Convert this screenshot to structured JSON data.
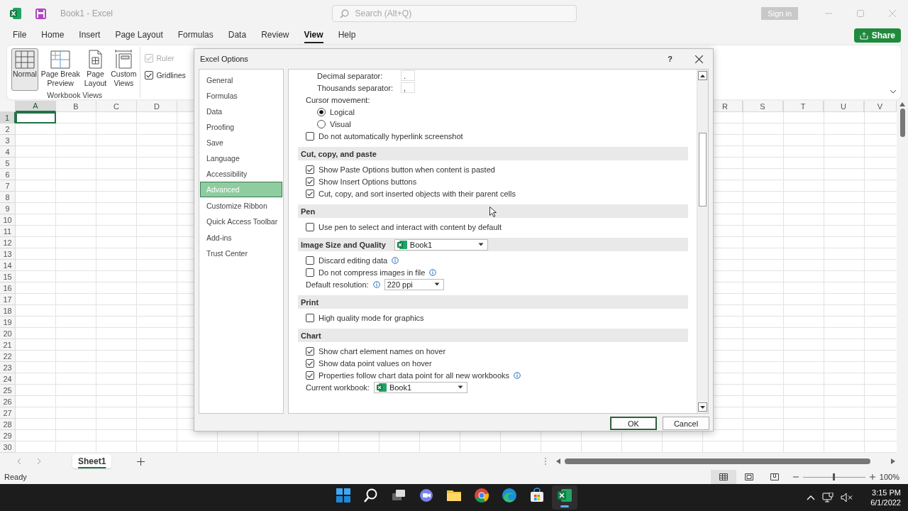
{
  "title_bar": {
    "title": "Book1 - Excel",
    "search_placeholder": "Search (Alt+Q)",
    "sign_in": "Sign in"
  },
  "ribbon_tabs": [
    {
      "label": "File",
      "selected": false
    },
    {
      "label": "Home",
      "selected": false
    },
    {
      "label": "Insert",
      "selected": false
    },
    {
      "label": "Page Layout",
      "selected": false
    },
    {
      "label": "Formulas",
      "selected": false
    },
    {
      "label": "Data",
      "selected": false
    },
    {
      "label": "Review",
      "selected": false
    },
    {
      "label": "View",
      "selected": true
    },
    {
      "label": "Help",
      "selected": false
    }
  ],
  "share_button": "Share",
  "ribbon": {
    "view_buttons": [
      {
        "kind": "normal",
        "label": "Normal",
        "selected": true
      },
      {
        "kind": "page_break",
        "label": "Page Break\nPreview",
        "selected": false
      },
      {
        "kind": "page_layout",
        "label": "Page\nLayout",
        "selected": false
      },
      {
        "kind": "custom",
        "label": "Custom\nViews",
        "selected": false
      }
    ],
    "group_label": "Workbook Views",
    "checkboxes": [
      {
        "label": "Ruler",
        "checked": true,
        "disabled": true
      },
      {
        "label": "Gridlines",
        "checked": true,
        "disabled": false
      }
    ]
  },
  "grid": {
    "columns_left": [
      {
        "label": "A",
        "selected": true
      },
      {
        "label": "B",
        "selected": false
      },
      {
        "label": "C",
        "selected": false
      },
      {
        "label": "D",
        "selected": false
      }
    ],
    "columns_right": [
      {
        "label": "R",
        "selected": false
      },
      {
        "label": "S",
        "selected": false
      },
      {
        "label": "T",
        "selected": false
      },
      {
        "label": "U",
        "selected": false
      },
      {
        "label": "V",
        "selected": false
      }
    ],
    "rows": [
      {
        "label": "1",
        "selected": true
      },
      {
        "label": "2",
        "selected": false
      },
      {
        "label": "3",
        "selected": false
      },
      {
        "label": "4",
        "selected": false
      },
      {
        "label": "5",
        "selected": false
      },
      {
        "label": "6",
        "selected": false
      },
      {
        "label": "7",
        "selected": false
      },
      {
        "label": "8",
        "selected": false
      },
      {
        "label": "9",
        "selected": false
      },
      {
        "label": "10",
        "selected": false
      },
      {
        "label": "11",
        "selected": false
      },
      {
        "label": "12",
        "selected": false
      },
      {
        "label": "13",
        "selected": false
      },
      {
        "label": "14",
        "selected": false
      },
      {
        "label": "15",
        "selected": false
      },
      {
        "label": "16",
        "selected": false
      },
      {
        "label": "17",
        "selected": false
      },
      {
        "label": "18",
        "selected": false
      },
      {
        "label": "19",
        "selected": false
      },
      {
        "label": "20",
        "selected": false
      },
      {
        "label": "21",
        "selected": false
      },
      {
        "label": "22",
        "selected": false
      },
      {
        "label": "23",
        "selected": false
      },
      {
        "label": "24",
        "selected": false
      },
      {
        "label": "25",
        "selected": false
      },
      {
        "label": "26",
        "selected": false
      },
      {
        "label": "27",
        "selected": false
      },
      {
        "label": "28",
        "selected": false
      },
      {
        "label": "29",
        "selected": false
      },
      {
        "label": "30",
        "selected": false
      }
    ]
  },
  "sheet_tabs": [
    {
      "label": "Sheet1",
      "selected": true
    }
  ],
  "status_bar": {
    "status": "Ready",
    "views": [
      {
        "kind": "normal",
        "selected": true
      },
      {
        "kind": "page_layout",
        "selected": false
      },
      {
        "kind": "page_break",
        "selected": false
      }
    ],
    "zoom": {
      "level": 0.5
    },
    "zoom_reading": "100%"
  },
  "taskbar": {
    "apps": [
      {
        "kind": "start",
        "active": false
      },
      {
        "kind": "search",
        "active": false
      },
      {
        "kind": "task_view",
        "active": false
      },
      {
        "kind": "chat",
        "active": false
      },
      {
        "kind": "explorer",
        "active": false
      },
      {
        "kind": "chrome",
        "active": false
      },
      {
        "kind": "edge",
        "active": false
      },
      {
        "kind": "store",
        "active": false
      },
      {
        "kind": "excel",
        "active": true
      }
    ],
    "time": "3:15 PM",
    "date": "6/1/2022"
  },
  "dialog": {
    "title": "Excel Options",
    "help": "?",
    "nav_groups": [
      [
        {
          "label": "General",
          "selected": false
        },
        {
          "label": "Formulas",
          "selected": false
        },
        {
          "label": "Data",
          "selected": false
        },
        {
          "label": "Proofing",
          "selected": false
        },
        {
          "label": "Save",
          "selected": false
        },
        {
          "label": "Language",
          "selected": false
        },
        {
          "label": "Accessibility",
          "selected": false
        },
        {
          "label": "Advanced",
          "selected": true
        }
      ],
      [
        {
          "label": "Customize Ribbon",
          "selected": false
        },
        {
          "label": "Quick Access Toolbar",
          "selected": false
        }
      ],
      [
        {
          "label": "Add-ins",
          "selected": false
        },
        {
          "label": "Trust Center",
          "selected": false
        }
      ]
    ],
    "settings": [
      {
        "kind": "field",
        "label": "Decimal separator:",
        "value": "."
      },
      {
        "kind": "field",
        "label": "Thousands separator:",
        "value": ","
      },
      {
        "kind": "label",
        "label": "Cursor movement:"
      },
      {
        "kind": "radio",
        "label": "Logical",
        "selected": true
      },
      {
        "kind": "radio",
        "label": "Visual",
        "selected": false
      },
      {
        "kind": "checkbox",
        "label": "Do not automatically hyperlink screenshot",
        "checked": false,
        "info": false
      },
      {
        "kind": "header",
        "label": "Cut, copy, and paste"
      },
      {
        "kind": "checkbox",
        "label": "Show Paste Options button when content is pasted",
        "checked": true,
        "info": false
      },
      {
        "kind": "checkbox",
        "label": "Show Insert Options buttons",
        "checked": true,
        "info": false
      },
      {
        "kind": "checkbox",
        "label": "Cut, copy, and sort inserted objects with their parent cells",
        "checked": true,
        "info": false
      },
      {
        "kind": "header",
        "label": "Pen"
      },
      {
        "kind": "checkbox",
        "label": "Use pen to select and interact with content by default",
        "checked": false,
        "info": false
      },
      {
        "kind": "header",
        "label": "Image Size and Quality",
        "dropdown": "Book1"
      },
      {
        "kind": "checkbox",
        "label": "Discard editing data",
        "checked": false,
        "info": true
      },
      {
        "kind": "checkbox",
        "label": "Do not compress images in file",
        "checked": false,
        "info": true
      },
      {
        "kind": "dropdown",
        "label": "Default resolution:",
        "info": true,
        "value": "220 ppi"
      },
      {
        "kind": "header",
        "label": "Print"
      },
      {
        "kind": "checkbox",
        "label": "High quality mode for graphics",
        "checked": false,
        "info": false
      },
      {
        "kind": "header",
        "label": "Chart"
      },
      {
        "kind": "checkbox",
        "label": "Show chart element names on hover",
        "checked": true,
        "info": false
      },
      {
        "kind": "checkbox",
        "label": "Show data point values on hover",
        "checked": true,
        "info": false
      },
      {
        "kind": "checkbox",
        "label": "Properties follow chart data point for all new workbooks",
        "checked": true,
        "info": true
      },
      {
        "kind": "workbook_dropdown",
        "label": "Current workbook:",
        "info": false,
        "value": "Book1"
      }
    ],
    "buttons": [
      {
        "label": "OK",
        "default": true
      },
      {
        "label": "Cancel",
        "default": false
      }
    ]
  }
}
